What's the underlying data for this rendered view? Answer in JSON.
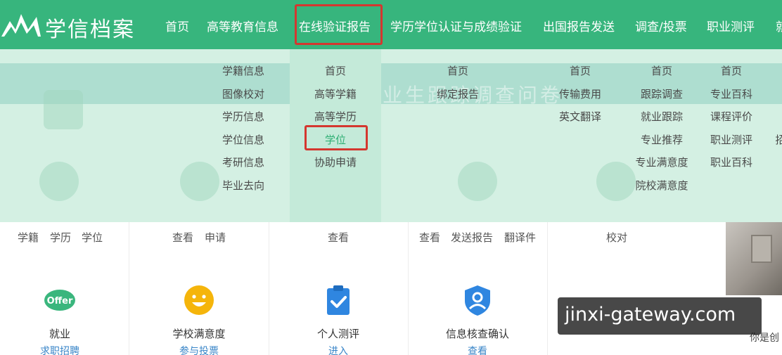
{
  "header": {
    "brand": "学信档案",
    "nav": [
      "首页",
      "高等教育信息",
      "在线验证报告",
      "学历学位认证与成绩验证",
      "出国报告发送",
      "调查/投票",
      "职业测评"
    ],
    "nav_partial": "就"
  },
  "dropdown": {
    "col_info": [
      "学籍信息",
      "图像校对",
      "学历信息",
      "学位信息",
      "考研信息",
      "毕业去向"
    ],
    "col_verify": [
      "首页",
      "高等学籍",
      "高等学历",
      "学位",
      "协助申请"
    ],
    "col_cert": [
      "首页",
      "绑定报告"
    ],
    "col_abroad": [
      "首页",
      "传输费用",
      "英文翻译"
    ],
    "col_survey": [
      "首页",
      "跟踪调查",
      "就业跟踪",
      "专业推荐",
      "专业满意度",
      "院校满意度"
    ],
    "col_career": [
      "首页",
      "专业百科",
      "课程评价",
      "职业测评",
      "职业百科"
    ],
    "col_partial": "招",
    "banner": "业生跟踪调查问卷"
  },
  "links": {
    "c1": [
      "学籍",
      "学历",
      "学位"
    ],
    "c2": [
      "查看",
      "申请"
    ],
    "c3": [
      "查看"
    ],
    "c4": [
      "查看",
      "发送报告",
      "翻译件"
    ],
    "c5": [
      "校对"
    ]
  },
  "services": [
    {
      "title": "就业",
      "link": "求职招聘",
      "icon_label": "Offer",
      "color": "#3ab67d"
    },
    {
      "title": "学校满意度",
      "link": "参与投票",
      "color": "#f5b50b"
    },
    {
      "title": "个人测评",
      "link": "进入",
      "color": "#2f86e0"
    },
    {
      "title": "信息核查确认",
      "link": "查看",
      "color": "#2f86e0"
    }
  ],
  "side": {
    "text": "你是创"
  },
  "watermark": "jinxi-gateway.com"
}
